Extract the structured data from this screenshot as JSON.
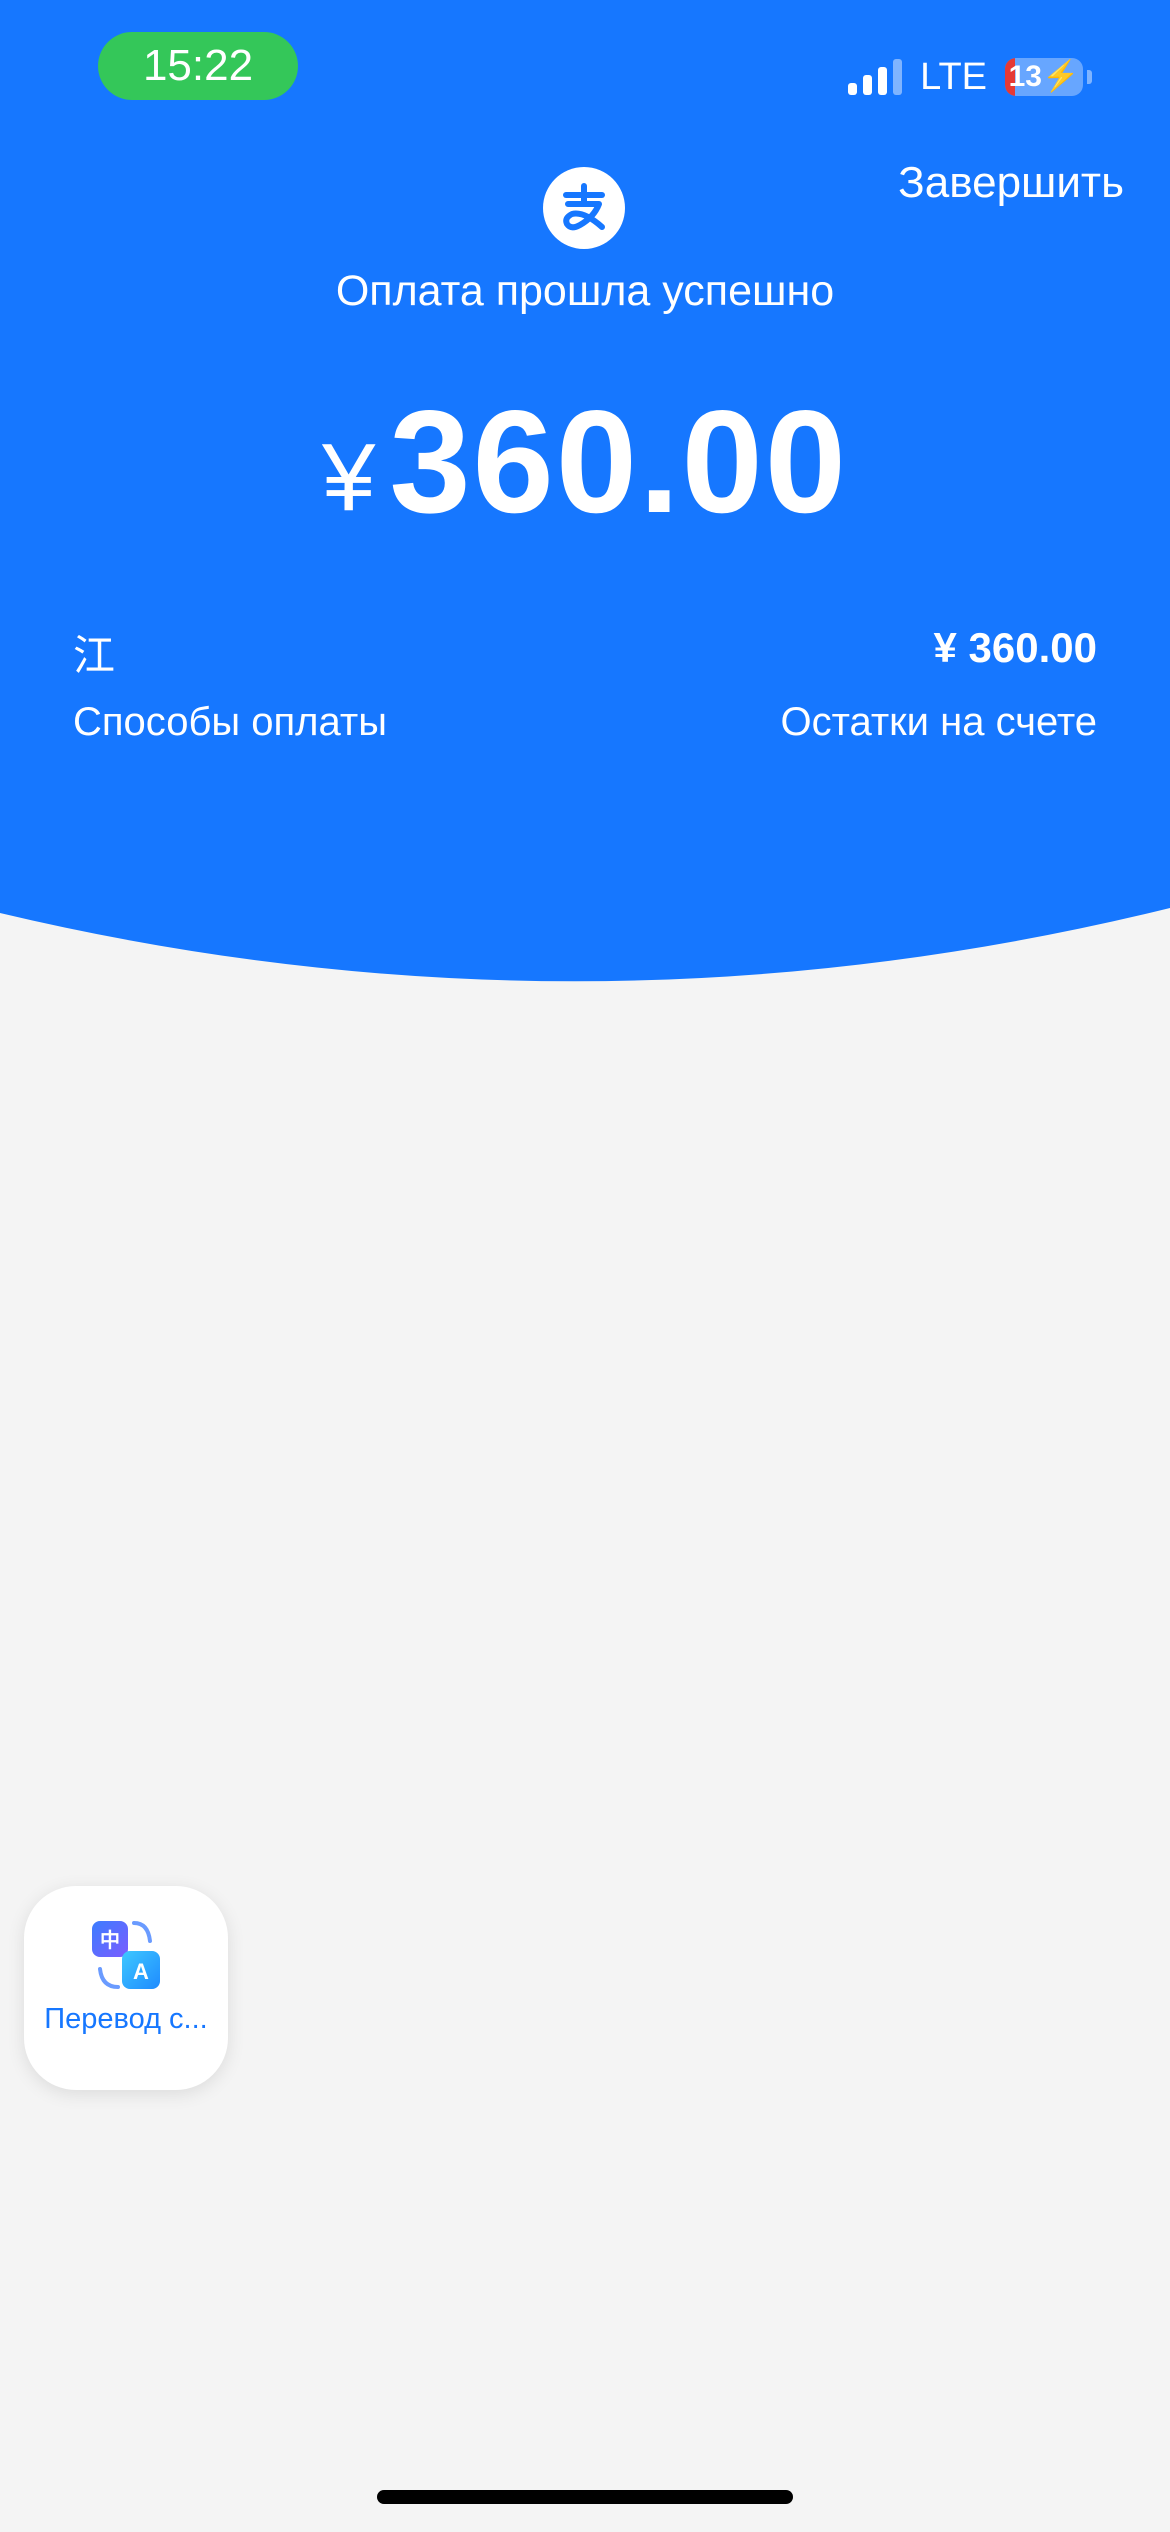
{
  "status_bar": {
    "time": "15:22",
    "network": "LTE",
    "battery": "13"
  },
  "header": {
    "finish_label": "Завершить",
    "status_title": "Оплата прошла успешно",
    "currency_symbol": "¥",
    "amount": "360.00"
  },
  "details": {
    "payer_char": "江",
    "payer_amount": "¥ 360.00",
    "payment_methods_label": "Способы оплаты",
    "balance_label": "Остатки на счете"
  },
  "float_widget": {
    "label": "Перевод с..."
  },
  "colors": {
    "brand_blue": "#1677ff",
    "page_bg": "#f4f4f4",
    "time_pill": "#34c759",
    "battery_low": "#e53935"
  },
  "icons": {
    "logo": "alipay-logo-icon",
    "widget": "translate-icon",
    "signal": "cellular-signal-icon",
    "battery": "battery-icon"
  }
}
